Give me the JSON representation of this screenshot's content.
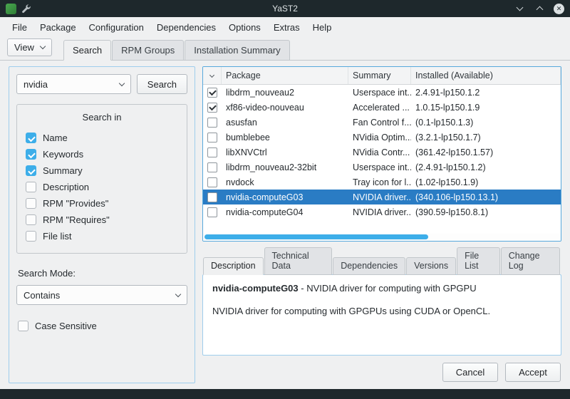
{
  "titlebar": {
    "title": "YaST2"
  },
  "menubar": {
    "items": [
      "File",
      "Package",
      "Configuration",
      "Dependencies",
      "Options",
      "Extras",
      "Help"
    ]
  },
  "view_selector": {
    "label": "View"
  },
  "main_tabs": [
    {
      "label": "Search",
      "active": true
    },
    {
      "label": "RPM Groups",
      "active": false
    },
    {
      "label": "Installation Summary",
      "active": false
    }
  ],
  "search_panel": {
    "query": "nvidia",
    "search_button_label": "Search",
    "group_title": "Search in",
    "checkboxes": [
      {
        "label": "Name",
        "checked": true
      },
      {
        "label": "Keywords",
        "checked": true
      },
      {
        "label": "Summary",
        "checked": true
      },
      {
        "label": "Description",
        "checked": false
      },
      {
        "label": "RPM \"Provides\"",
        "checked": false
      },
      {
        "label": "RPM \"Requires\"",
        "checked": false
      },
      {
        "label": "File list",
        "checked": false
      }
    ],
    "search_mode_label": "Search Mode:",
    "search_mode_value": "Contains",
    "case_sensitive_label": "Case Sensitive",
    "case_sensitive_checked": false
  },
  "package_table": {
    "columns": [
      "Package",
      "Summary",
      "Installed (Available)"
    ],
    "rows": [
      {
        "checked": true,
        "selected": false,
        "package": "libdrm_nouveau2",
        "summary": "Userspace int...",
        "installed": "2.4.91-lp150.1.2"
      },
      {
        "checked": true,
        "selected": false,
        "package": "xf86-video-nouveau",
        "summary": "Accelerated ...",
        "installed": "1.0.15-lp150.1.9"
      },
      {
        "checked": false,
        "selected": false,
        "package": "asusfan",
        "summary": "Fan Control f...",
        "installed": "(0.1-lp150.1.3)"
      },
      {
        "checked": false,
        "selected": false,
        "package": "bumblebee",
        "summary": "NVidia Optim...",
        "installed": "(3.2.1-lp150.1.7)"
      },
      {
        "checked": false,
        "selected": false,
        "package": "libXNVCtrl",
        "summary": "NVidia Contr...",
        "installed": "(361.42-lp150.1.57)"
      },
      {
        "checked": false,
        "selected": false,
        "package": "libdrm_nouveau2-32bit",
        "summary": "Userspace int...",
        "installed": "(2.4.91-lp150.1.2)"
      },
      {
        "checked": false,
        "selected": false,
        "package": "nvdock",
        "summary": "Tray icon for l...",
        "installed": "(1.02-lp150.1.9)"
      },
      {
        "checked": false,
        "selected": true,
        "package": "nvidia-computeG03",
        "summary": "NVIDIA driver...",
        "installed": "(340.106-lp150.13.1)"
      },
      {
        "checked": false,
        "selected": false,
        "package": "nvidia-computeG04",
        "summary": "NVIDIA driver...",
        "installed": "(390.59-lp150.8.1)"
      }
    ]
  },
  "detail_tabs": [
    {
      "label": "Description",
      "active": true
    },
    {
      "label": "Technical Data",
      "active": false
    },
    {
      "label": "Dependencies",
      "active": false
    },
    {
      "label": "Versions",
      "active": false
    },
    {
      "label": "File List",
      "active": false
    },
    {
      "label": "Change Log",
      "active": false
    }
  ],
  "description_panel": {
    "package_name": "nvidia-computeG03",
    "headline_rest": " - NVIDIA driver for computing with GPGPU",
    "body": "NVIDIA driver for computing with GPGPUs using CUDA or OpenCL."
  },
  "footer": {
    "cancel_label": "Cancel",
    "accept_label": "Accept"
  },
  "colors": {
    "accent": "#3daee9",
    "selection": "#2a7cc4",
    "titlebar": "#1e282c"
  }
}
